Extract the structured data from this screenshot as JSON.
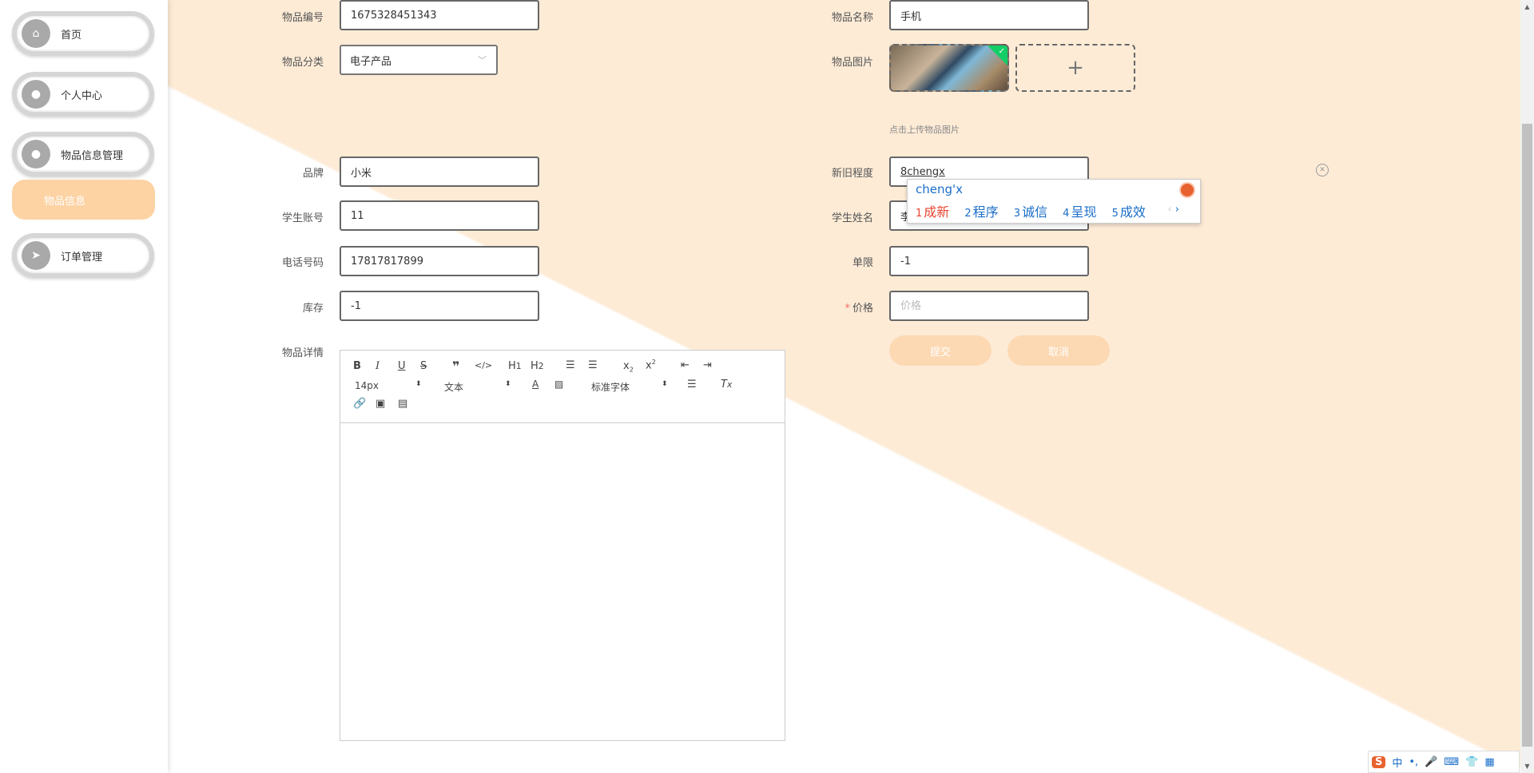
{
  "sidebar": {
    "items": [
      {
        "label": "首页",
        "icon": "home-icon"
      },
      {
        "label": "个人中心",
        "icon": "user-icon"
      },
      {
        "label": "物品信息管理",
        "icon": "user-icon"
      },
      {
        "label": "订单管理",
        "icon": "send-icon"
      }
    ],
    "submenu_active": "物品信息"
  },
  "form": {
    "item_no": {
      "label": "物品编号",
      "value": "1675328451343"
    },
    "item_name": {
      "label": "物品名称",
      "value": "手机"
    },
    "category": {
      "label": "物品分类",
      "value": "电子产品"
    },
    "item_image": {
      "label": "物品图片",
      "hint": "点击上传物品图片"
    },
    "brand": {
      "label": "品牌",
      "value": "小米"
    },
    "condition": {
      "label": "新旧程度",
      "value": "8chengx"
    },
    "student_account": {
      "label": "学生账号",
      "value": "11"
    },
    "student_name": {
      "label": "学生姓名",
      "value": "李"
    },
    "phone": {
      "label": "电话号码",
      "value": "17817817899"
    },
    "limit": {
      "label": "单限",
      "value": "-1"
    },
    "stock": {
      "label": "库存",
      "value": "-1"
    },
    "price": {
      "label": "价格",
      "placeholder": "价格",
      "required_mark": "*"
    },
    "details": {
      "label": "物品详情"
    },
    "submit_label": "提交",
    "cancel_label": "取消"
  },
  "editor": {
    "font_size": "14px",
    "block_format": "文本",
    "font_family": "标准字体"
  },
  "ime": {
    "composition": "cheng'x",
    "candidates": [
      {
        "num": "1",
        "text": "成新"
      },
      {
        "num": "2",
        "text": "程序"
      },
      {
        "num": "3",
        "text": "诚信"
      },
      {
        "num": "4",
        "text": "呈现"
      },
      {
        "num": "5",
        "text": "成效"
      }
    ],
    "lang": "中",
    "punct": "•,"
  },
  "colors": {
    "accent": "#fdd3a4",
    "button": "#fcd9b3",
    "background_triangle": "#fdebd6"
  }
}
